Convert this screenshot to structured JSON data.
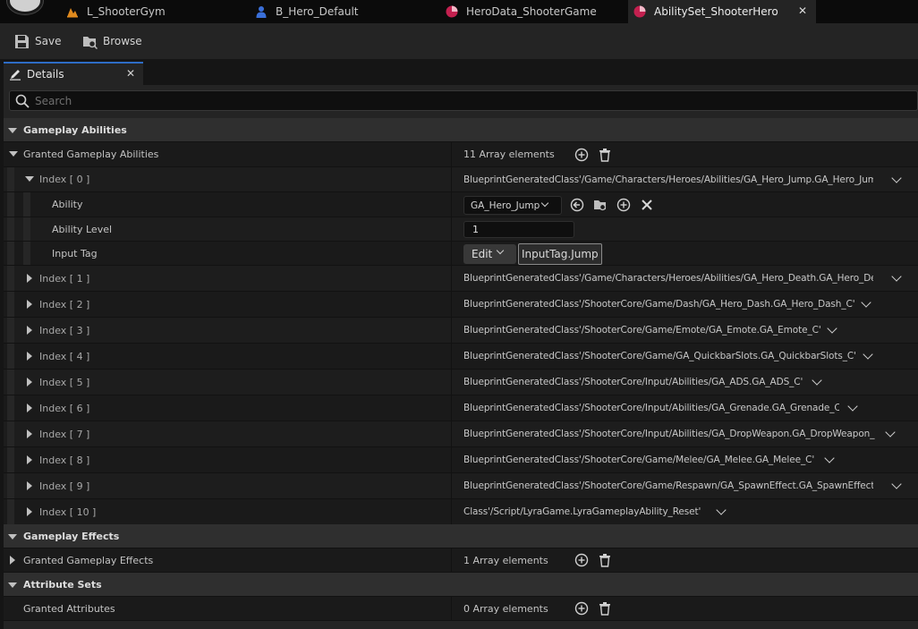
{
  "tabs": [
    {
      "label": "L_ShooterGym",
      "icon": "level-icon",
      "color": "#e08a1e",
      "active": false
    },
    {
      "label": "B_Hero_Default",
      "icon": "blueprint-icon",
      "color": "#3a6fd8",
      "active": false
    },
    {
      "label": "HeroData_ShooterGame",
      "icon": "data-asset-icon",
      "color": "#c3204f",
      "active": false
    },
    {
      "label": "AbilitySet_ShooterHero",
      "icon": "data-asset-icon",
      "color": "#c3204f",
      "active": true
    }
  ],
  "toolbar": {
    "save_label": "Save",
    "browse_label": "Browse"
  },
  "panel": {
    "title": "Details"
  },
  "search": {
    "placeholder": "Search"
  },
  "sections": {
    "abilities": {
      "title": "Gameplay Abilities",
      "property_label": "Granted Gameplay Abilities",
      "count_label": "11 Array elements",
      "expanded": {
        "index_label": "Index [ 0 ]",
        "path": "BlueprintGeneratedClass'/Game/Characters/Heroes/Abilities/GA_Hero_Jump.GA_Hero_Jump_C'",
        "ability_label": "Ability",
        "ability_value": "GA_Hero_Jump",
        "level_label": "Ability Level",
        "level_value": "1",
        "input_tag_label": "Input Tag",
        "edit_label": "Edit",
        "tag_value": "InputTag.Jump"
      },
      "items": [
        {
          "index": "Index [ 1 ]",
          "path": "BlueprintGeneratedClass'/Game/Characters/Heroes/Abilities/GA_Hero_Death.GA_Hero_Death_C'"
        },
        {
          "index": "Index [ 2 ]",
          "path": "BlueprintGeneratedClass'/ShooterCore/Game/Dash/GA_Hero_Dash.GA_Hero_Dash_C'"
        },
        {
          "index": "Index [ 3 ]",
          "path": "BlueprintGeneratedClass'/ShooterCore/Game/Emote/GA_Emote.GA_Emote_C'"
        },
        {
          "index": "Index [ 4 ]",
          "path": "BlueprintGeneratedClass'/ShooterCore/Game/GA_QuickbarSlots.GA_QuickbarSlots_C'"
        },
        {
          "index": "Index [ 5 ]",
          "path": "BlueprintGeneratedClass'/ShooterCore/Input/Abilities/GA_ADS.GA_ADS_C'"
        },
        {
          "index": "Index [ 6 ]",
          "path": "BlueprintGeneratedClass'/ShooterCore/Input/Abilities/GA_Grenade.GA_Grenade_C'"
        },
        {
          "index": "Index [ 7 ]",
          "path": "BlueprintGeneratedClass'/ShooterCore/Input/Abilities/GA_DropWeapon.GA_DropWeapon_C'"
        },
        {
          "index": "Index [ 8 ]",
          "path": "BlueprintGeneratedClass'/ShooterCore/Game/Melee/GA_Melee.GA_Melee_C'"
        },
        {
          "index": "Index [ 9 ]",
          "path": "BlueprintGeneratedClass'/ShooterCore/Game/Respawn/GA_SpawnEffect.GA_SpawnEffect_C'"
        },
        {
          "index": "Index [ 10 ]",
          "path": "Class'/Script/LyraGame.LyraGameplayAbility_Reset'"
        }
      ]
    },
    "effects": {
      "title": "Gameplay Effects",
      "property_label": "Granted Gameplay Effects",
      "count_label": "1 Array elements"
    },
    "attributes": {
      "title": "Attribute Sets",
      "property_label": "Granted Attributes",
      "count_label": "0 Array elements"
    }
  }
}
